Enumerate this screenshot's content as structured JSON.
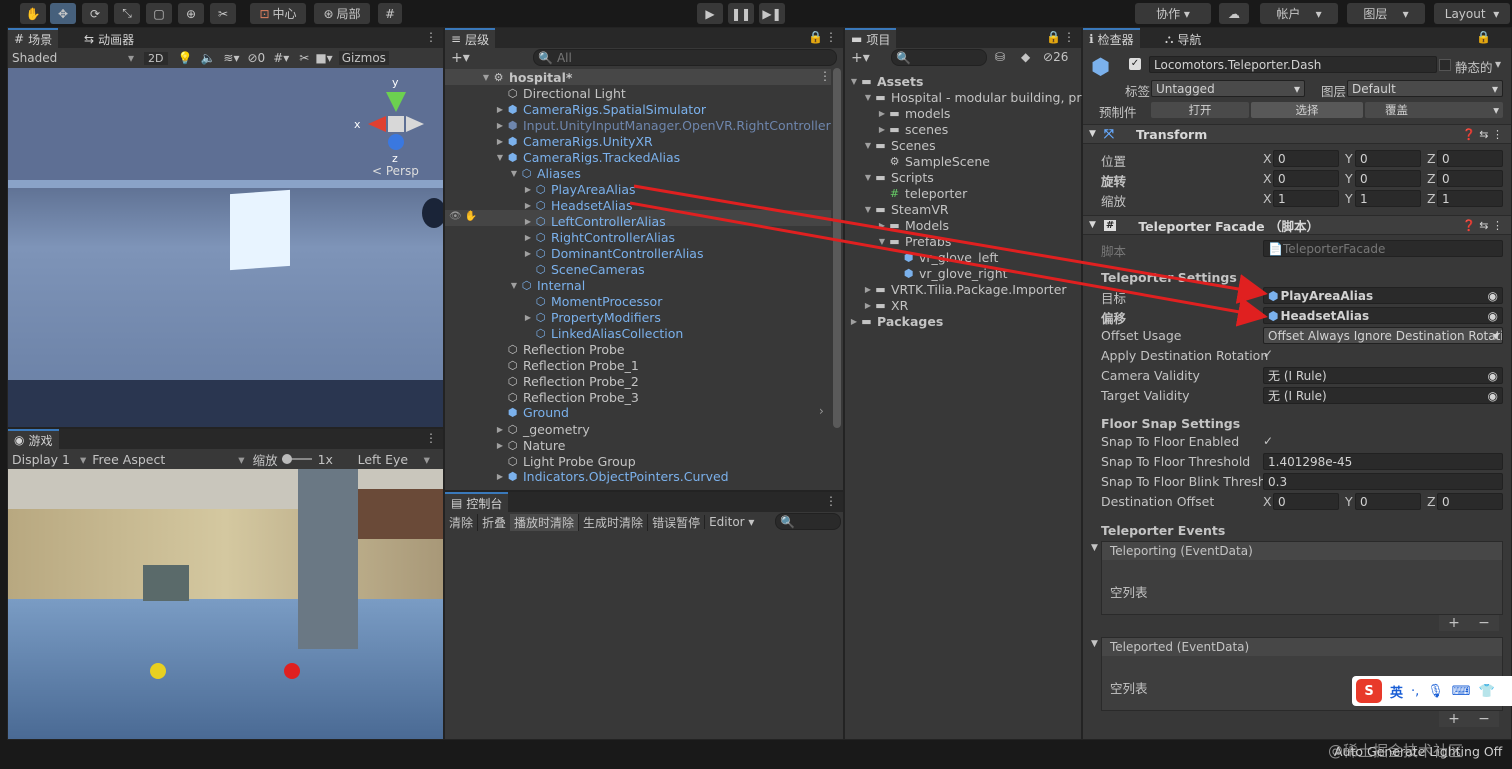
{
  "toolbar": {
    "pivot": "中心",
    "local": "局部",
    "collab": "协作",
    "account": "帐户",
    "layers": "图层",
    "layout": "Layout"
  },
  "scene": {
    "tab_scene": "场景",
    "tab_animator": "动画器",
    "shading": "Shaded",
    "mode2d": "2D",
    "gizmos": "Gizmos",
    "persp": "< Persp",
    "axis_x": "x",
    "axis_y": "y",
    "axis_z": "z",
    "hidden_count": "0"
  },
  "game": {
    "tab": "游戏",
    "display": "Display 1",
    "aspect": "Free Aspect",
    "scale_label": "缩放",
    "scale_value": "1x",
    "eye": "Left Eye"
  },
  "hierarchy": {
    "tab": "层级",
    "search_placeholder": "All",
    "items": [
      {
        "label": "hospital*"
      },
      {
        "label": "Directional Light"
      },
      {
        "label": "CameraRigs.SpatialSimulator"
      },
      {
        "label": "Input.UnityInputManager.OpenVR.RightController"
      },
      {
        "label": "CameraRigs.UnityXR"
      },
      {
        "label": "CameraRigs.TrackedAlias"
      },
      {
        "label": "Aliases"
      },
      {
        "label": "PlayAreaAlias"
      },
      {
        "label": "HeadsetAlias"
      },
      {
        "label": "LeftControllerAlias"
      },
      {
        "label": "RightControllerAlias"
      },
      {
        "label": "DominantControllerAlias"
      },
      {
        "label": "SceneCameras"
      },
      {
        "label": "Internal"
      },
      {
        "label": "MomentProcessor"
      },
      {
        "label": "PropertyModifiers"
      },
      {
        "label": "LinkedAliasCollection"
      },
      {
        "label": "Reflection Probe"
      },
      {
        "label": "Reflection Probe_1"
      },
      {
        "label": "Reflection Probe_2"
      },
      {
        "label": "Reflection Probe_3"
      },
      {
        "label": "Ground"
      },
      {
        "label": "_geometry"
      },
      {
        "label": "Nature"
      },
      {
        "label": "Light Probe Group"
      },
      {
        "label": "Indicators.ObjectPointers.Curved"
      }
    ]
  },
  "console": {
    "tab": "控制台",
    "clear": "清除",
    "collapse": "折叠",
    "clear_on_play": "播放时清除",
    "clear_on_build": "生成时清除",
    "error_pause": "错误暂停",
    "editor": "Editor"
  },
  "project": {
    "tab": "项目",
    "count": "26",
    "items": [
      {
        "label": "Assets"
      },
      {
        "label": "Hospital - modular building, pro"
      },
      {
        "label": "models"
      },
      {
        "label": "scenes"
      },
      {
        "label": "Scenes"
      },
      {
        "label": "SampleScene"
      },
      {
        "label": "Scripts"
      },
      {
        "label": "teleporter"
      },
      {
        "label": "SteamVR"
      },
      {
        "label": "Models"
      },
      {
        "label": "Prefabs"
      },
      {
        "label": "vr_glove_left"
      },
      {
        "label": "vr_glove_right"
      },
      {
        "label": "VRTK.Tilia.Package.Importer"
      },
      {
        "label": "XR"
      },
      {
        "label": "Packages"
      }
    ]
  },
  "inspector": {
    "tab": "检查器",
    "tab_nav": "导航",
    "object_name": "Locomotors.Teleporter.Dash",
    "static": "静态的",
    "tag_label": "标签",
    "tag": "Untagged",
    "layer_label": "图层",
    "layer": "Default",
    "prefab_label": "预制件",
    "open": "打开",
    "select": "选择",
    "overrides": "覆盖",
    "transform": {
      "title": "Transform",
      "pos": "位置",
      "rot": "旋转",
      "scale": "缩放",
      "x": "X",
      "y": "Y",
      "z": "Z",
      "pos_x": "0",
      "pos_y": "0",
      "pos_z": "0",
      "rot_x": "0",
      "rot_y": "0",
      "rot_z": "0",
      "sc_x": "1",
      "sc_y": "1",
      "sc_z": "1"
    },
    "facade": {
      "title": "Teleporter Facade （脚本）",
      "script_label": "脚本",
      "script": "TeleporterFacade",
      "settings": "Teleporter Settings",
      "target_label": "目标",
      "target": "PlayAreaAlias",
      "offset_label": "偏移",
      "offset": "HeadsetAlias",
      "offset_usage_label": "Offset Usage",
      "offset_usage": "Offset Always Ignore Destination Rotation",
      "apply_rot_label": "Apply Destination Rotation",
      "camera_validity_label": "Camera Validity",
      "camera_validity": "无 (I Rule)",
      "target_validity_label": "Target Validity",
      "target_validity": "无 (I Rule)",
      "floor_snap": "Floor Snap Settings",
      "snap_enabled_label": "Snap To Floor Enabled",
      "snap_threshold_label": "Snap To Floor Threshold",
      "snap_threshold": "1.401298e-45",
      "snap_blink_label": "Snap To Floor Blink Thresh",
      "snap_blink": "0.3",
      "dest_offset_label": "Destination Offset",
      "do_x": "0",
      "do_y": "0",
      "do_z": "0",
      "events": "Teleporter Events",
      "teleporting": "Teleporting (EventData)",
      "empty": "空列表",
      "teleported": "Teleported (EventData)"
    }
  },
  "status": {
    "lighting": "Auto Generate Lighting Off",
    "watermark": "@稀土掘金技术社区"
  },
  "ime": {
    "lang": "英"
  },
  "colors": {
    "arrow": "#e02020",
    "selection": "#46607c",
    "accent": "#3a79bb"
  }
}
